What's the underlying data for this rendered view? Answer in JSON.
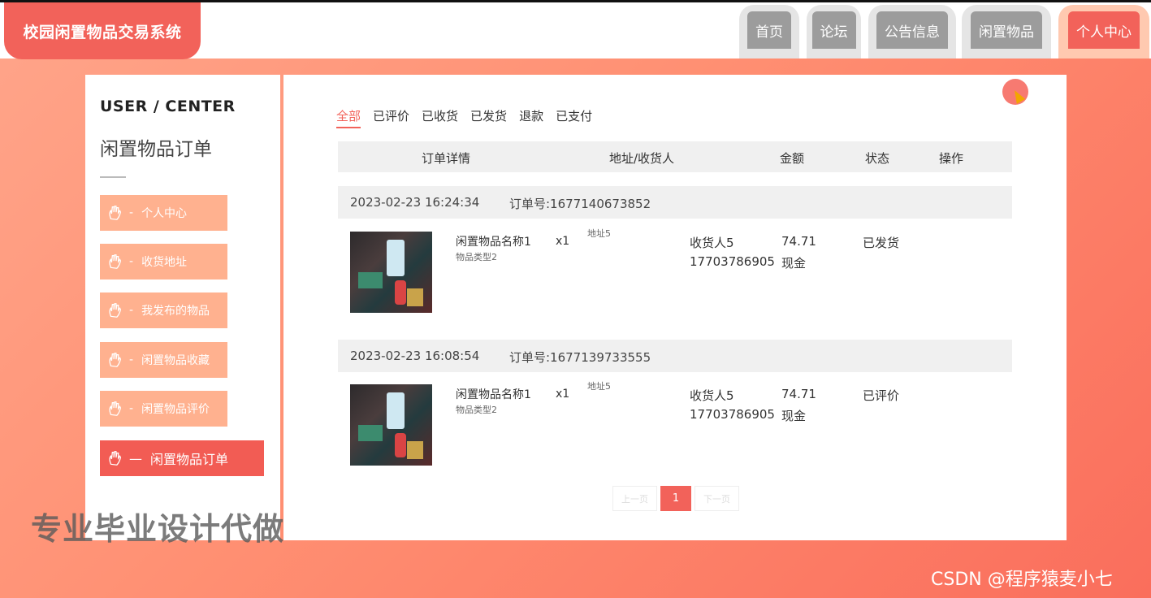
{
  "app": {
    "logo_text": "校园闲置物品交易系统"
  },
  "nav": [
    {
      "label": "首页"
    },
    {
      "label": "论坛"
    },
    {
      "label": "公告信息"
    },
    {
      "label": "闲置物品"
    },
    {
      "label": "个人中心"
    }
  ],
  "sidebar": {
    "title": "USER / CENTER",
    "subtitle": "闲置物品订单",
    "items": [
      {
        "dash": "-",
        "label": "个人中心"
      },
      {
        "dash": "-",
        "label": "收货地址"
      },
      {
        "dash": "-",
        "label": "我发布的物品"
      },
      {
        "dash": "-",
        "label": "闲置物品收藏"
      },
      {
        "dash": "-",
        "label": "闲置物品评价"
      },
      {
        "dash": "—",
        "label": "闲置物品订单"
      }
    ]
  },
  "tabs": [
    "全部",
    "已评价",
    "已收货",
    "已发货",
    "退款",
    "已支付"
  ],
  "table": {
    "headers": [
      "订单详情",
      "地址/收货人",
      "金额",
      "状态",
      "操作"
    ]
  },
  "orders": [
    {
      "date": "2023-02-23 16:24:34",
      "order_no": "订单号:1677140673852",
      "product_name": "闲置物品名称1",
      "product_type": "物品类型2",
      "qty": "x1",
      "address": "地址5",
      "receiver": "收货人5",
      "phone": "17703786905",
      "amount": "74.71",
      "pay_method": "现金",
      "status": "已发货"
    },
    {
      "date": "2023-02-23 16:08:54",
      "order_no": "订单号:1677139733555",
      "product_name": "闲置物品名称1",
      "product_type": "物品类型2",
      "qty": "x1",
      "address": "地址5",
      "receiver": "收货人5",
      "phone": "17703786905",
      "amount": "74.71",
      "pay_method": "现金",
      "status": "已评价"
    }
  ],
  "pager": {
    "prev": "上一页",
    "current": "1",
    "next": "下一页"
  },
  "watermark": "专业毕业设计代做",
  "credit": "CSDN @程序猿麦小七",
  "colors": {
    "accent": "#f2625a",
    "sidebar_btn": "#ffb18f",
    "nav_inactive": "#9c9c9c"
  }
}
